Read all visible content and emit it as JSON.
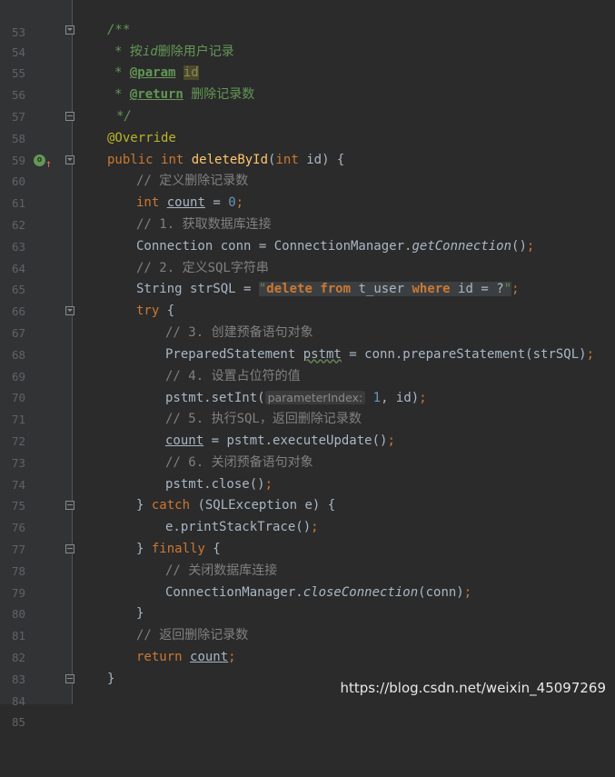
{
  "watermark": "https://blog.csdn.net/weixin_45097269",
  "gutter_icon": "override-method-icon",
  "lines": [
    {
      "n": "53"
    },
    {
      "n": "54",
      "fold": "open",
      "doc_open": "/**"
    },
    {
      "n": "55",
      "d_star": "* ",
      "d_text1": "按",
      "d_id": "id",
      "d_text2": "删除用户记录"
    },
    {
      "n": "56",
      "d_star": "* ",
      "d_tag": "@param",
      "d_param": "id"
    },
    {
      "n": "57",
      "d_star": "* ",
      "d_tag": "@return",
      "d_ret": " 删除记录数"
    },
    {
      "n": "58",
      "fold": "close",
      "d_end": "*/"
    },
    {
      "n": "59",
      "annotation": "@Override"
    },
    {
      "n": "60",
      "fold": "open",
      "m_pub": "public",
      "m_int": "int",
      "m_name": "deleteById",
      "m_p1": "(",
      "m_pint": "int",
      "m_p2": " id) {"
    },
    {
      "n": "61",
      "comment": "// 定义删除记录数"
    },
    {
      "n": "62",
      "v_int": "int",
      "v_count": "count",
      "v_eq": " = ",
      "v_zero": "0",
      "v_semi": ";"
    },
    {
      "n": "63",
      "comment": "// 1. 获取数据库连接"
    },
    {
      "n": "64",
      "c_a": "Connection conn = ConnectionManager.",
      "c_fn": "getConnection",
      "c_b": "()",
      "c_semi": ";"
    },
    {
      "n": "65",
      "comment": "// 2. 定义SQL字符串"
    },
    {
      "n": "66",
      "s_a": "String strSQL = ",
      "s_q1": "\"",
      "s_k1": "delete",
      "s_sp1": " ",
      "s_k2": "from",
      "s_mid": " t_user ",
      "s_k3": "where",
      "s_end": " id = ?",
      "s_q2": "\"",
      "s_semi": ";"
    },
    {
      "n": "67",
      "fold": "open",
      "t_try": "try",
      "t_b": " {"
    },
    {
      "n": "68",
      "comment": "// 3. 创建预备语句对象"
    },
    {
      "n": "69",
      "p_a": "PreparedStatement ",
      "p_var": "pstmt",
      "p_b": " = conn.prepareStatement(strSQL)",
      "p_semi": ";"
    },
    {
      "n": "70",
      "comment": "// 4. 设置占位符的值"
    },
    {
      "n": "71",
      "i_a": "pstmt.setInt(",
      "i_hint": "parameterIndex:",
      "i_num": " 1",
      "i_b": ", id)",
      "i_semi": ";"
    },
    {
      "n": "72",
      "comment": "// 5. 执行SQL，返回删除记录数"
    },
    {
      "n": "73",
      "u_var": "count",
      "u_b": " = pstmt.executeUpdate()",
      "u_semi": ";"
    },
    {
      "n": "74",
      "comment": "// 6. 关闭预备语句对象"
    },
    {
      "n": "75",
      "x_a": "pstmt.close()",
      "x_semi": ";"
    },
    {
      "n": "76",
      "fold": "close",
      "k_a": "} ",
      "k_catch": "catch",
      "k_b": " (SQLException e) {"
    },
    {
      "n": "77",
      "e_a": "e.printStackTrace()",
      "e_semi": ";"
    },
    {
      "n": "78",
      "fold": "close",
      "f_a": "} ",
      "f_kw": "finally",
      "f_b": " {"
    },
    {
      "n": "79",
      "comment": "// 关闭数据库连接"
    },
    {
      "n": "80",
      "cc_a": "ConnectionManager.",
      "cc_fn": "closeConnection",
      "cc_b": "(conn)",
      "cc_semi": ";"
    },
    {
      "n": "81",
      "brace": "}"
    },
    {
      "n": "82",
      "comment": "// 返回删除记录数"
    },
    {
      "n": "83",
      "r_kw": "return",
      "r_sp": " ",
      "r_var": "count",
      "r_semi": ";"
    },
    {
      "n": "84",
      "fold": "close",
      "brace": "}"
    },
    {
      "n": "85"
    }
  ]
}
